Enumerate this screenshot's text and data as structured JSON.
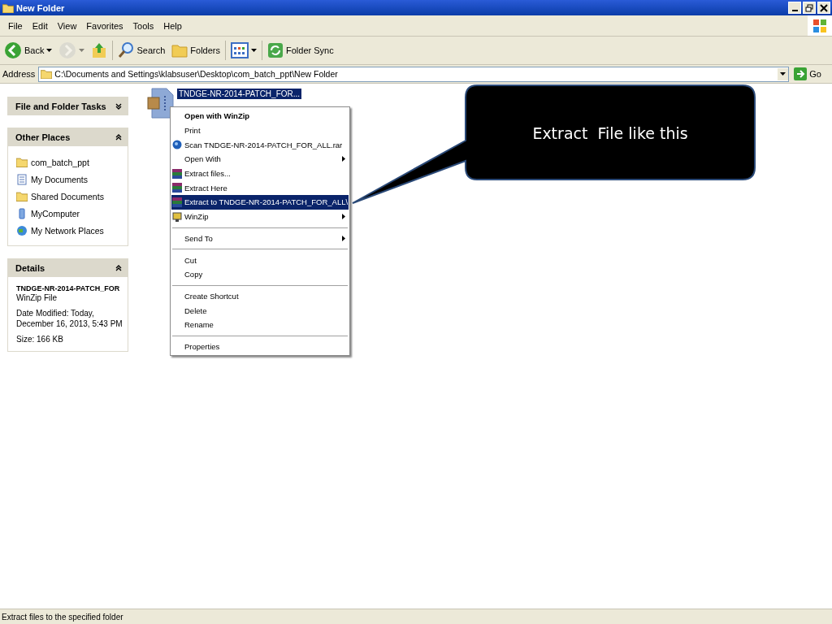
{
  "window": {
    "title": "New Folder"
  },
  "menu_bar": [
    "File",
    "Edit",
    "View",
    "Favorites",
    "Tools",
    "Help"
  ],
  "toolbar": [
    {
      "kind": "back",
      "label": "Back",
      "disabled": false
    },
    {
      "kind": "forward",
      "disabled": true
    },
    {
      "kind": "up",
      "disabled": false
    },
    {
      "kind": "search",
      "label": "Search",
      "disabled": false
    },
    {
      "kind": "folders",
      "label": "Folders",
      "disabled": false
    },
    {
      "kind": "views",
      "disabled": false
    },
    {
      "kind": "sync",
      "label": "Folder Sync",
      "disabled": false
    }
  ],
  "address_bar": {
    "label": "Address",
    "value": "C:\\Documents and Settings\\klabsuser\\Desktop\\com_batch_ppt\\New Folder",
    "go": "Go"
  },
  "sidebar": {
    "panels": [
      {
        "kind": "tasks",
        "title": "File and Folder Tasks",
        "expanded": false
      },
      {
        "kind": "places",
        "title": "Other Places",
        "expanded": true,
        "items": [
          {
            "kind": "folder",
            "label": "com_batch_ppt"
          },
          {
            "kind": "documents",
            "label": "My Documents"
          },
          {
            "kind": "folder",
            "label": "Shared Documents"
          },
          {
            "kind": "computer",
            "label": "MyComputer"
          },
          {
            "kind": "network",
            "label": "My Network Places"
          }
        ]
      },
      {
        "kind": "details",
        "title": "Details",
        "expanded": true,
        "name": "TNDGE-NR-2014-PATCH_FOR",
        "type": "WinZip File",
        "modified": "Date Modified: Today, December 16, 2013, 5:43 PM",
        "size": "Size: 166 KB"
      }
    ]
  },
  "file": {
    "name": "TNDGE-NR-2014-PATCH_FOR...",
    "selected": true
  },
  "context_menu": {
    "groups": [
      [
        {
          "label": "Open with WinZip",
          "kind": "plain",
          "default": true,
          "submenu": false,
          "selected": false
        },
        {
          "label": "Print",
          "kind": "plain",
          "default": false,
          "submenu": false,
          "selected": false
        },
        {
          "label": "Scan TNDGE-NR-2014-PATCH_FOR_ALL.rar",
          "kind": "scan",
          "default": false,
          "submenu": false,
          "selected": false
        },
        {
          "label": "Open With",
          "kind": "plain",
          "default": false,
          "submenu": true,
          "selected": false
        },
        {
          "label": "Extract files...",
          "kind": "rar",
          "default": false,
          "submenu": false,
          "selected": false
        },
        {
          "label": "Extract Here",
          "kind": "rar",
          "default": false,
          "submenu": false,
          "selected": false
        },
        {
          "label": "Extract to TNDGE-NR-2014-PATCH_FOR_ALL\\",
          "kind": "rar",
          "default": false,
          "submenu": false,
          "selected": true
        },
        {
          "label": "WinZip",
          "kind": "winzip",
          "default": false,
          "submenu": true,
          "selected": false
        }
      ],
      [
        {
          "label": "Send To",
          "kind": "plain",
          "default": false,
          "submenu": true,
          "selected": false
        }
      ],
      [
        {
          "label": "Cut",
          "kind": "plain",
          "default": false,
          "submenu": false,
          "selected": false
        },
        {
          "label": "Copy",
          "kind": "plain",
          "default": false,
          "submenu": false,
          "selected": false
        }
      ],
      [
        {
          "label": "Create Shortcut",
          "kind": "plain",
          "default": false,
          "submenu": false,
          "selected": false
        },
        {
          "label": "Delete",
          "kind": "plain",
          "default": false,
          "submenu": false,
          "selected": false
        },
        {
          "label": "Rename",
          "kind": "plain",
          "default": false,
          "submenu": false,
          "selected": false
        }
      ],
      [
        {
          "label": "Properties",
          "kind": "plain",
          "default": false,
          "submenu": false,
          "selected": false
        }
      ]
    ]
  },
  "callout": {
    "text": "Extract  File like this"
  },
  "status_bar": "Extract files to the specified folder"
}
